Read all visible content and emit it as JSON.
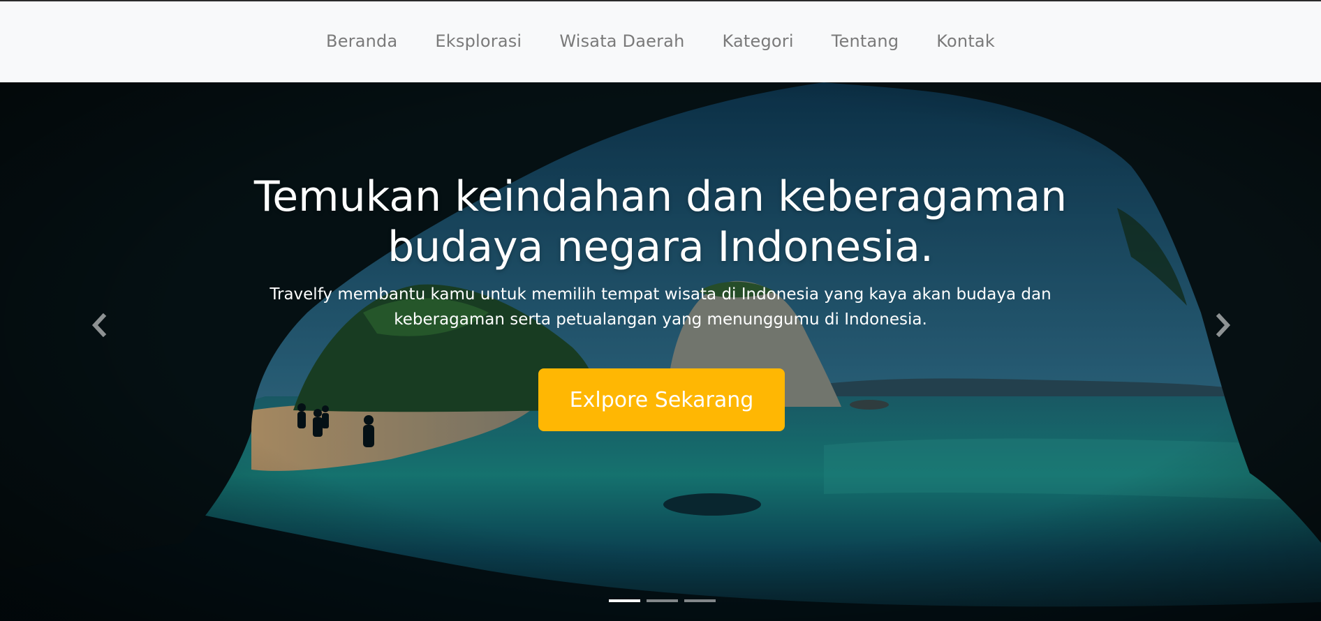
{
  "navbar": {
    "links": [
      "Beranda",
      "Eksplorasi",
      "Wisata Daerah",
      "Kategori",
      "Tentang",
      "Kontak"
    ]
  },
  "hero": {
    "headline": "Temukan keindahan dan keberagaman budaya negara Indonesia.",
    "subtext": "Travelfy membantu kamu untuk memilih tempat wisata di Indonesia yang kaya akan budaya dan keberagaman serta petualangan yang menunggumu di Indonesia.",
    "cta_label": "Exlpore Sekarang"
  },
  "carousel": {
    "prev_icon": "chevron-left-icon",
    "next_icon": "chevron-right-icon",
    "slide_count": 3,
    "active_index": 0
  },
  "colors": {
    "navbar_bg": "#f8f9fa",
    "nav_text": "#7a7a7a",
    "cta_bg": "#ffb703",
    "hero_text": "#ffffff"
  }
}
